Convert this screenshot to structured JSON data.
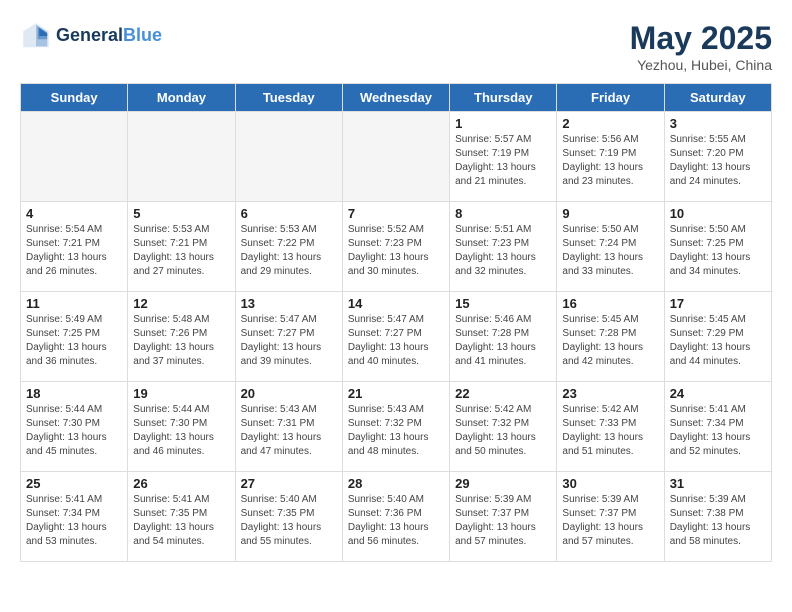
{
  "header": {
    "logo_line1": "General",
    "logo_line2": "Blue",
    "month": "May 2025",
    "location": "Yezhou, Hubei, China"
  },
  "weekdays": [
    "Sunday",
    "Monday",
    "Tuesday",
    "Wednesday",
    "Thursday",
    "Friday",
    "Saturday"
  ],
  "weeks": [
    [
      {
        "day": "",
        "detail": ""
      },
      {
        "day": "",
        "detail": ""
      },
      {
        "day": "",
        "detail": ""
      },
      {
        "day": "",
        "detail": ""
      },
      {
        "day": "1",
        "detail": "Sunrise: 5:57 AM\nSunset: 7:19 PM\nDaylight: 13 hours\nand 21 minutes."
      },
      {
        "day": "2",
        "detail": "Sunrise: 5:56 AM\nSunset: 7:19 PM\nDaylight: 13 hours\nand 23 minutes."
      },
      {
        "day": "3",
        "detail": "Sunrise: 5:55 AM\nSunset: 7:20 PM\nDaylight: 13 hours\nand 24 minutes."
      }
    ],
    [
      {
        "day": "4",
        "detail": "Sunrise: 5:54 AM\nSunset: 7:21 PM\nDaylight: 13 hours\nand 26 minutes."
      },
      {
        "day": "5",
        "detail": "Sunrise: 5:53 AM\nSunset: 7:21 PM\nDaylight: 13 hours\nand 27 minutes."
      },
      {
        "day": "6",
        "detail": "Sunrise: 5:53 AM\nSunset: 7:22 PM\nDaylight: 13 hours\nand 29 minutes."
      },
      {
        "day": "7",
        "detail": "Sunrise: 5:52 AM\nSunset: 7:23 PM\nDaylight: 13 hours\nand 30 minutes."
      },
      {
        "day": "8",
        "detail": "Sunrise: 5:51 AM\nSunset: 7:23 PM\nDaylight: 13 hours\nand 32 minutes."
      },
      {
        "day": "9",
        "detail": "Sunrise: 5:50 AM\nSunset: 7:24 PM\nDaylight: 13 hours\nand 33 minutes."
      },
      {
        "day": "10",
        "detail": "Sunrise: 5:50 AM\nSunset: 7:25 PM\nDaylight: 13 hours\nand 34 minutes."
      }
    ],
    [
      {
        "day": "11",
        "detail": "Sunrise: 5:49 AM\nSunset: 7:25 PM\nDaylight: 13 hours\nand 36 minutes."
      },
      {
        "day": "12",
        "detail": "Sunrise: 5:48 AM\nSunset: 7:26 PM\nDaylight: 13 hours\nand 37 minutes."
      },
      {
        "day": "13",
        "detail": "Sunrise: 5:47 AM\nSunset: 7:27 PM\nDaylight: 13 hours\nand 39 minutes."
      },
      {
        "day": "14",
        "detail": "Sunrise: 5:47 AM\nSunset: 7:27 PM\nDaylight: 13 hours\nand 40 minutes."
      },
      {
        "day": "15",
        "detail": "Sunrise: 5:46 AM\nSunset: 7:28 PM\nDaylight: 13 hours\nand 41 minutes."
      },
      {
        "day": "16",
        "detail": "Sunrise: 5:45 AM\nSunset: 7:28 PM\nDaylight: 13 hours\nand 42 minutes."
      },
      {
        "day": "17",
        "detail": "Sunrise: 5:45 AM\nSunset: 7:29 PM\nDaylight: 13 hours\nand 44 minutes."
      }
    ],
    [
      {
        "day": "18",
        "detail": "Sunrise: 5:44 AM\nSunset: 7:30 PM\nDaylight: 13 hours\nand 45 minutes."
      },
      {
        "day": "19",
        "detail": "Sunrise: 5:44 AM\nSunset: 7:30 PM\nDaylight: 13 hours\nand 46 minutes."
      },
      {
        "day": "20",
        "detail": "Sunrise: 5:43 AM\nSunset: 7:31 PM\nDaylight: 13 hours\nand 47 minutes."
      },
      {
        "day": "21",
        "detail": "Sunrise: 5:43 AM\nSunset: 7:32 PM\nDaylight: 13 hours\nand 48 minutes."
      },
      {
        "day": "22",
        "detail": "Sunrise: 5:42 AM\nSunset: 7:32 PM\nDaylight: 13 hours\nand 50 minutes."
      },
      {
        "day": "23",
        "detail": "Sunrise: 5:42 AM\nSunset: 7:33 PM\nDaylight: 13 hours\nand 51 minutes."
      },
      {
        "day": "24",
        "detail": "Sunrise: 5:41 AM\nSunset: 7:34 PM\nDaylight: 13 hours\nand 52 minutes."
      }
    ],
    [
      {
        "day": "25",
        "detail": "Sunrise: 5:41 AM\nSunset: 7:34 PM\nDaylight: 13 hours\nand 53 minutes."
      },
      {
        "day": "26",
        "detail": "Sunrise: 5:41 AM\nSunset: 7:35 PM\nDaylight: 13 hours\nand 54 minutes."
      },
      {
        "day": "27",
        "detail": "Sunrise: 5:40 AM\nSunset: 7:35 PM\nDaylight: 13 hours\nand 55 minutes."
      },
      {
        "day": "28",
        "detail": "Sunrise: 5:40 AM\nSunset: 7:36 PM\nDaylight: 13 hours\nand 56 minutes."
      },
      {
        "day": "29",
        "detail": "Sunrise: 5:39 AM\nSunset: 7:37 PM\nDaylight: 13 hours\nand 57 minutes."
      },
      {
        "day": "30",
        "detail": "Sunrise: 5:39 AM\nSunset: 7:37 PM\nDaylight: 13 hours\nand 57 minutes."
      },
      {
        "day": "31",
        "detail": "Sunrise: 5:39 AM\nSunset: 7:38 PM\nDaylight: 13 hours\nand 58 minutes."
      }
    ]
  ]
}
